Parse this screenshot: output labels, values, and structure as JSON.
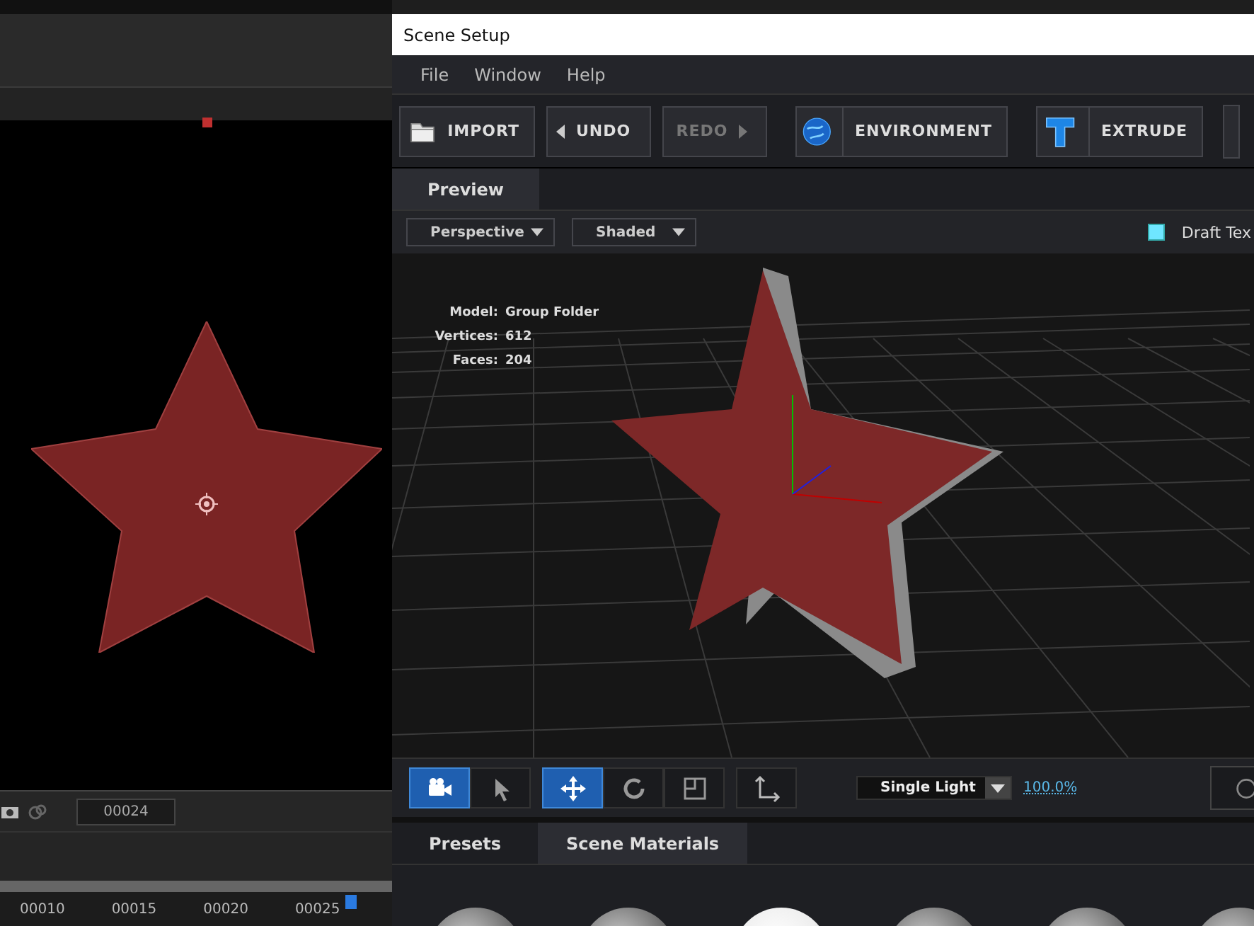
{
  "left_panel": {
    "timecode": "00024",
    "ruler_labels": [
      "00010",
      "00015",
      "00020",
      "00025"
    ]
  },
  "window": {
    "title": "Scene Setup"
  },
  "menu": [
    "File",
    "Window",
    "Help"
  ],
  "toolbar": [
    {
      "label": "IMPORT",
      "kind": "folder",
      "disabled": false
    },
    {
      "label": "UNDO",
      "kind": "back",
      "disabled": false
    },
    {
      "label": "REDO",
      "kind": "forward",
      "disabled": true
    },
    {
      "label": "ENVIRONMENT",
      "kind": "globe",
      "disabled": false
    },
    {
      "label": "EXTRUDE",
      "kind": "extrude",
      "disabled": false
    }
  ],
  "tabs": [
    {
      "label": "Preview",
      "selected": true
    }
  ],
  "view_options": {
    "camera": "Perspective",
    "shading": "Shaded",
    "draft": {
      "label": "Draft Tex",
      "checked": true
    }
  },
  "model_info": [
    {
      "label": "Model:",
      "value": "Group Folder"
    },
    {
      "label": "Vertices:",
      "value": "612"
    },
    {
      "label": "Faces:",
      "value": "204"
    }
  ],
  "tools": [
    {
      "kind": "camera",
      "selected": true
    },
    {
      "kind": "pointer",
      "selected": false
    },
    {
      "kind": "move",
      "selected": true
    },
    {
      "kind": "rotate",
      "selected": false
    },
    {
      "kind": "scale",
      "selected": false
    },
    {
      "kind": "axes",
      "selected": false
    }
  ],
  "light": {
    "mode": "Single Light",
    "intensity": "100.0%"
  },
  "bottom_tabs": [
    {
      "label": "Presets",
      "selected": false
    },
    {
      "label": "Scene Materials",
      "selected": true
    }
  ],
  "materials": [
    {
      "kind": "marble"
    },
    {
      "kind": "marble"
    },
    {
      "kind": "white"
    },
    {
      "kind": "marble"
    },
    {
      "kind": "marble"
    },
    {
      "kind": "marble"
    }
  ]
}
